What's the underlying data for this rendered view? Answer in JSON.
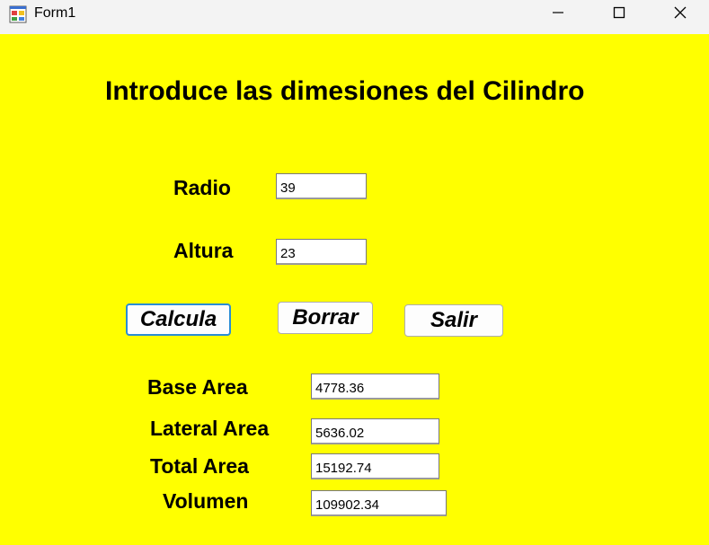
{
  "window": {
    "title": "Form1",
    "app_icon": "form-app-icon",
    "controls": [
      "minimize-icon",
      "maximize-icon",
      "close-icon"
    ]
  },
  "form": {
    "heading": "Introduce las dimesiones del Cilindro",
    "inputs": {
      "radio_label": "Radio",
      "radio_value": "39",
      "altura_label": "Altura",
      "altura_value": "23"
    },
    "buttons": {
      "calcula": "Calcula",
      "borrar": "Borrar",
      "salir": "Salir"
    },
    "results": {
      "base_area_label": "Base Area",
      "base_area_value": "4778.36",
      "lateral_area_label": "Lateral Area",
      "lateral_area_value": "5636.02",
      "total_area_label": "Total Area",
      "total_area_value": "15192.74",
      "volumen_label": "Volumen",
      "volumen_value": "109902.34"
    }
  },
  "colors": {
    "form_background": "#ffff00",
    "titlebar_background": "#f3f3f3",
    "focus_border": "#2a8dd4"
  }
}
